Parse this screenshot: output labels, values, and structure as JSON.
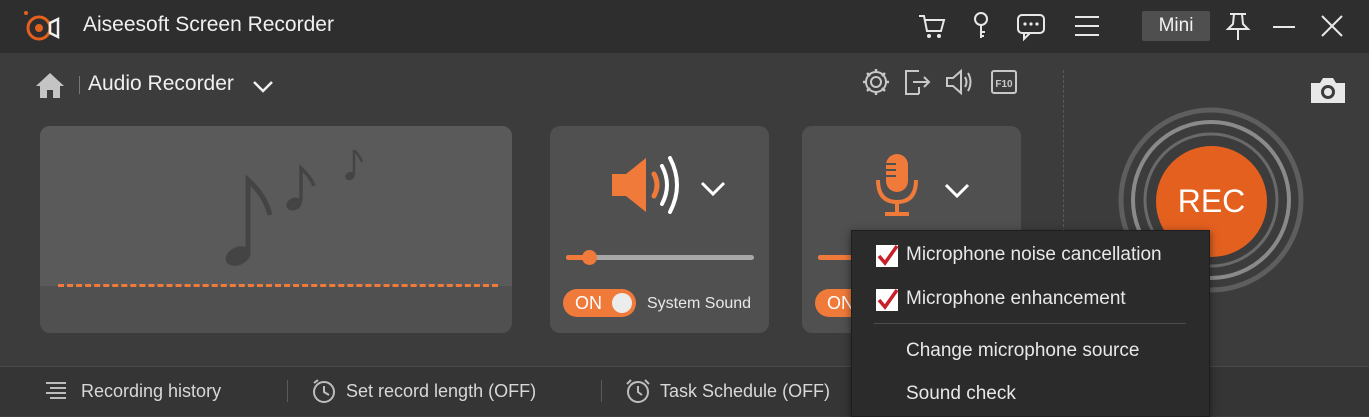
{
  "app": {
    "title": "Aiseesoft Screen Recorder"
  },
  "titlebar": {
    "mini_label": "Mini",
    "icons": [
      "cart-icon",
      "key-icon",
      "feedback-icon",
      "menu-icon",
      "pin-icon",
      "minimize-icon",
      "close-icon"
    ]
  },
  "header": {
    "mode_title": "Audio Recorder",
    "icons": [
      "settings-icon",
      "export-icon",
      "volume-icon",
      "f10-hotkey-icon"
    ]
  },
  "system_sound": {
    "label": "System Sound",
    "toggle": "ON",
    "volume_fraction": 0.12
  },
  "microphone": {
    "toggle": "ON",
    "volume_fraction": 0.3
  },
  "rec": {
    "label": "REC"
  },
  "footer": {
    "history": "Recording history",
    "length": "Set record length (OFF)",
    "schedule": "Task Schedule (OFF)"
  },
  "mic_menu": {
    "noise_cancel": "Microphone noise cancellation",
    "enhancement": "Microphone enhancement",
    "change_source": "Change microphone source",
    "sound_check": "Sound check"
  },
  "colors": {
    "accent": "#f07a3a",
    "rec": "#e4601f",
    "check": "#c8202a"
  }
}
